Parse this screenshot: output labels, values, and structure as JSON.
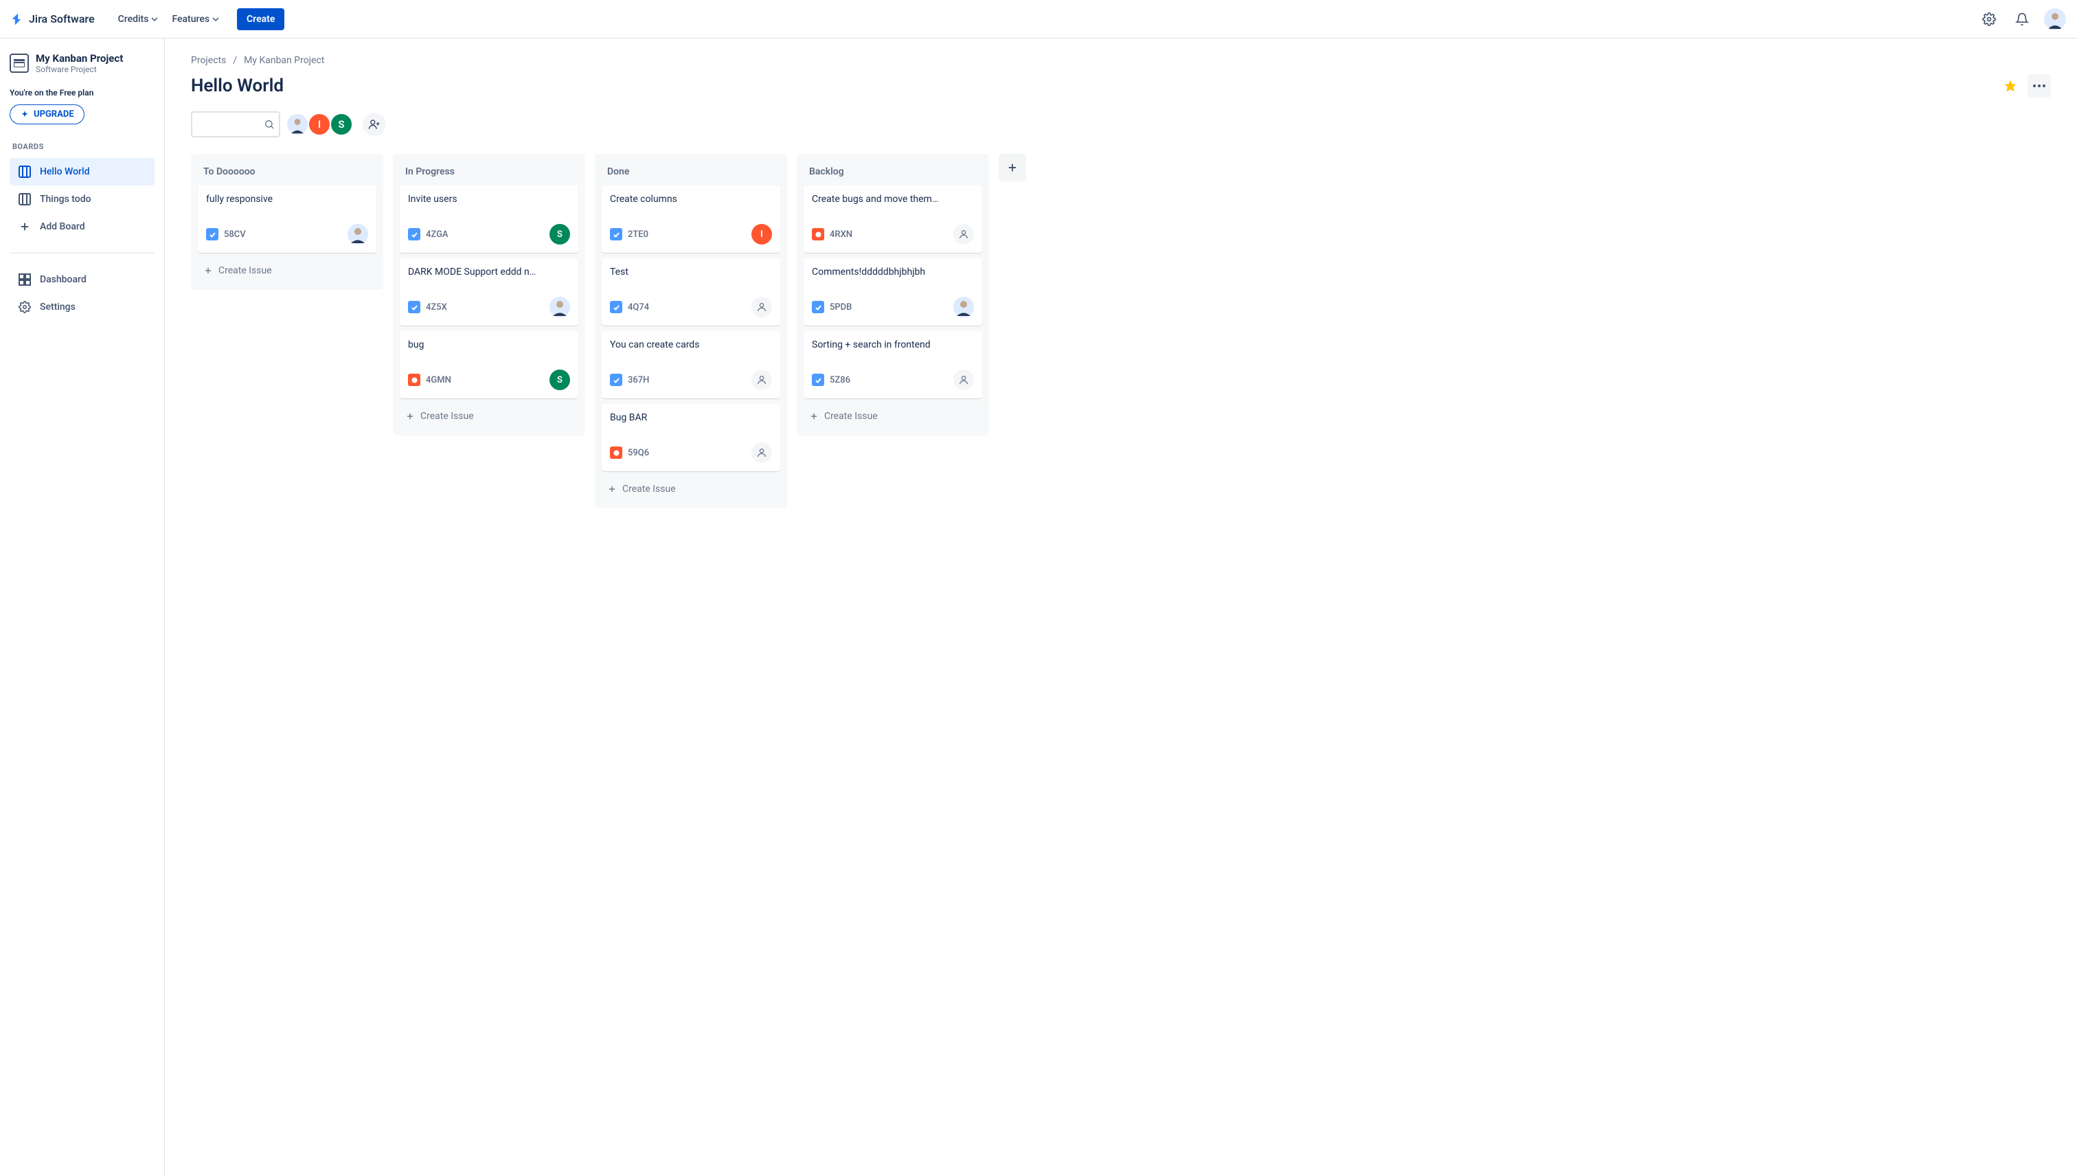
{
  "nav": {
    "product": "Jira Software",
    "items": [
      "Credits",
      "Features"
    ],
    "create": "Create"
  },
  "sidebar": {
    "project_title": "My Kanban Project",
    "project_sub": "Software Project",
    "plan_text": "You're on the Free plan",
    "upgrade": "UPGRADE",
    "boards_label": "BOARDS",
    "boards": [
      {
        "label": "Hello World",
        "active": true
      },
      {
        "label": "Things todo",
        "active": false
      }
    ],
    "add_board": "Add Board",
    "links": [
      {
        "label": "Dashboard"
      },
      {
        "label": "Settings"
      }
    ]
  },
  "breadcrumb": {
    "root": "Projects",
    "current": "My Kanban Project"
  },
  "board": {
    "title": "Hello World"
  },
  "people": [
    {
      "type": "photo"
    },
    {
      "type": "initial",
      "initial": "I",
      "bg": "#ff5630"
    },
    {
      "type": "initial",
      "initial": "S",
      "bg": "#00875a"
    }
  ],
  "create_issue_label": "Create Issue",
  "columns": [
    {
      "title": "To Doooooo",
      "show_create": true,
      "cards": [
        {
          "title": "fully responsive",
          "key": "58CV",
          "type": "task",
          "assignee": {
            "kind": "photo"
          }
        }
      ]
    },
    {
      "title": "In Progress",
      "show_create": true,
      "cards": [
        {
          "title": "Invite users",
          "key": "4ZGA",
          "type": "task",
          "assignee": {
            "kind": "initial",
            "initial": "S",
            "bg": "#00875a"
          }
        },
        {
          "title": "DARK MODE Support eddd n…",
          "key": "4Z5X",
          "type": "task",
          "assignee": {
            "kind": "photo"
          }
        },
        {
          "title": "bug",
          "key": "4GMN",
          "type": "bug",
          "assignee": {
            "kind": "initial",
            "initial": "S",
            "bg": "#00875a"
          }
        }
      ]
    },
    {
      "title": "Done",
      "show_create": true,
      "cards": [
        {
          "title": "Create columns",
          "key": "2TE0",
          "type": "task",
          "assignee": {
            "kind": "initial",
            "initial": "I",
            "bg": "#ff5630"
          }
        },
        {
          "title": "Test",
          "key": "4Q74",
          "type": "task",
          "assignee": {
            "kind": "unassigned"
          }
        },
        {
          "title": "You can create cards",
          "key": "367H",
          "type": "task",
          "assignee": {
            "kind": "unassigned"
          }
        },
        {
          "title": "Bug BAR",
          "key": "59Q6",
          "type": "bug",
          "assignee": {
            "kind": "unassigned"
          }
        }
      ]
    },
    {
      "title": "Backlog",
      "show_create": true,
      "cards": [
        {
          "title": "Create bugs and move them…",
          "key": "4RXN",
          "type": "bug",
          "assignee": {
            "kind": "unassigned"
          }
        },
        {
          "title": "Comments!dddddbhjbhjbh",
          "key": "5PDB",
          "type": "task",
          "assignee": {
            "kind": "photo"
          }
        },
        {
          "title": "Sorting + search in frontend",
          "key": "5Z86",
          "type": "task",
          "assignee": {
            "kind": "unassigned"
          }
        }
      ]
    }
  ]
}
